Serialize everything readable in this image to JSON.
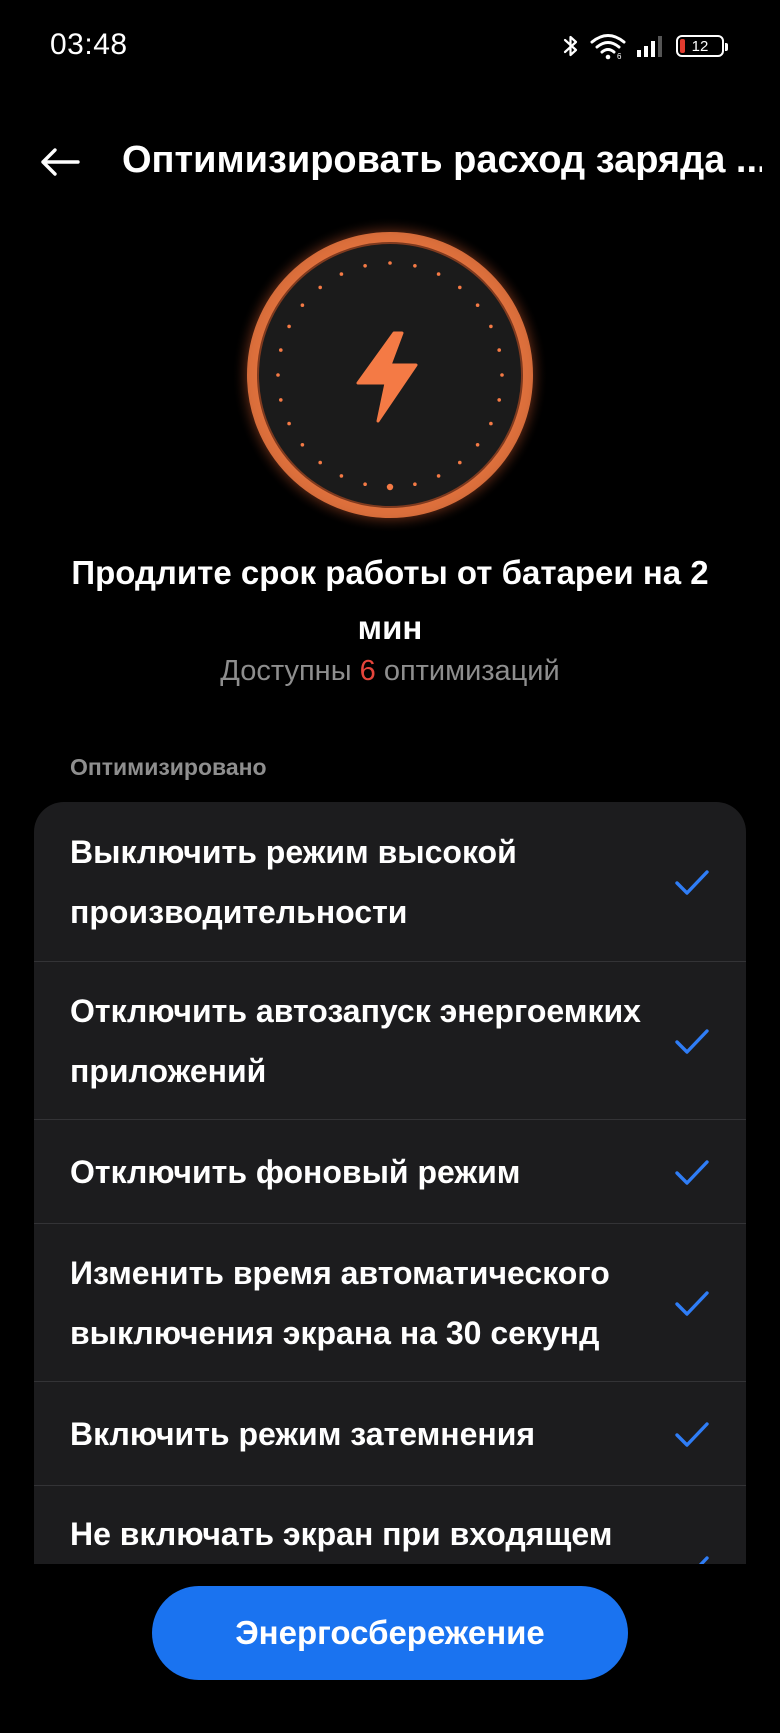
{
  "status_bar": {
    "time": "03:48",
    "battery_level": "12",
    "battery_fraction": 0.12,
    "icons": [
      "bluetooth-icon",
      "wifi-icon",
      "signal-icon",
      "battery-icon"
    ]
  },
  "header": {
    "back_icon": "arrow-left-icon",
    "title": "Оптимизировать расход заряда ..."
  },
  "hero": {
    "icon": "lightning-icon",
    "accent_color": "#f47a45"
  },
  "summary": {
    "headline": "Продлите срок работы от батареи на 2 мин",
    "available_prefix": "Доступны",
    "available_count": "6",
    "available_suffix": "оптимизаций"
  },
  "section": {
    "label": "Оптимизировано"
  },
  "items": [
    {
      "label": "Выключить режим высокой производительности",
      "checked": true
    },
    {
      "label": "Отключить автозапуск энергоемких приложений",
      "checked": true
    },
    {
      "label": "Отключить фоновый режим",
      "checked": true
    },
    {
      "label": "Изменить время автоматического выключения экрана на 30 секунд",
      "checked": true
    },
    {
      "label": "Включить режим затемнения",
      "checked": true
    },
    {
      "label": "Не включать экран при входящем",
      "checked": true
    }
  ],
  "action": {
    "button_label": "Энергосбережение"
  },
  "colors": {
    "background": "#000000",
    "card": "#1c1c1e",
    "check": "#2f7df6",
    "button": "#1a73f0",
    "count_accent": "#e5453b"
  }
}
